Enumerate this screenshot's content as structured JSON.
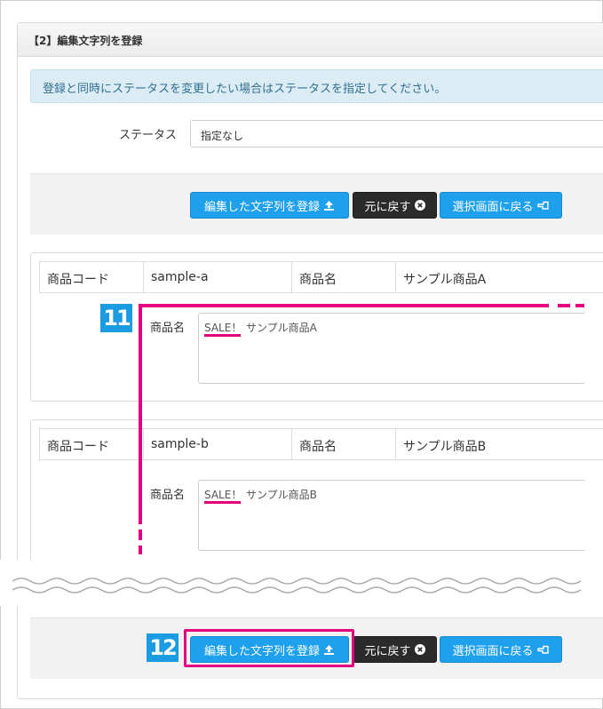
{
  "panel": {
    "title": "【2】編集文字列を登録"
  },
  "alert": {
    "message": "登録と同時にステータスを変更したい場合はステータスを指定してください。"
  },
  "status": {
    "label": "ステータス",
    "value": "指定なし"
  },
  "buttons": {
    "register": "編集した文字列を登録",
    "reset": "元に戻す",
    "back": "選択画面に戻る"
  },
  "products": [
    {
      "code_label": "商品コード",
      "code": "sample-a",
      "name_label": "商品名",
      "name": "サンプル商品A",
      "field_label": "商品名",
      "sale": "SALE！",
      "field_name": "サンプル商品A"
    },
    {
      "code_label": "商品コード",
      "code": "sample-b",
      "name_label": "商品名",
      "name": "サンプル商品B",
      "field_label": "商品名",
      "sale": "SALE！",
      "field_name": "サンプル商品B"
    }
  ],
  "callouts": {
    "step11": "11",
    "step12": "12"
  },
  "colors": {
    "primary": "#1fa0ec",
    "dark": "#2b2b2b",
    "accent": "#e3007f",
    "badge": "#1a9be2",
    "alert_bg": "#dcecf5",
    "alert_text": "#31708f"
  },
  "icons": {
    "upload": "upload-icon",
    "close": "close-circle-icon",
    "back": "hand-point-left-icon"
  }
}
